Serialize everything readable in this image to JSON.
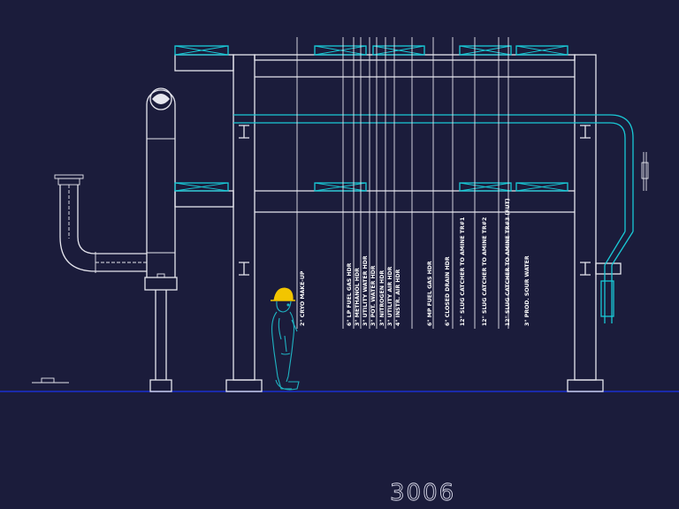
{
  "drawing": {
    "sheet_number": "3006",
    "pipe_labels": [
      "2\" CRYO MAKE-UP",
      "6\" LP FUEL GAS HDR",
      "3\" METHANOL HDR",
      "3\" UTILITY WATER HDR",
      "3\" POT. WATER HDR",
      "3\" NITROGEN HDR",
      "3\" UTILITY AIR HDR",
      "4\" INSTR. AIR HDR",
      "6\" MP FUEL GAS HDR",
      "6\" CLOSED DRAIN HDR",
      "12\" SLUG CATCHER TO AMINE TR#1",
      "12\" SLUG CATCHER TO AMINE TR#2",
      "12\" SLUG CATCHER TO AMINE TR#3 (FUT)",
      "3\" PROD. SOUR WATER"
    ]
  },
  "colors": {
    "background": "#1b1c3b",
    "structure": "#e6e6ee",
    "pipe_accent": "#19c9d6",
    "ground_line": "#1a2fd0",
    "hard_hat": "#f2c500",
    "worker": "#1fb3c2"
  }
}
